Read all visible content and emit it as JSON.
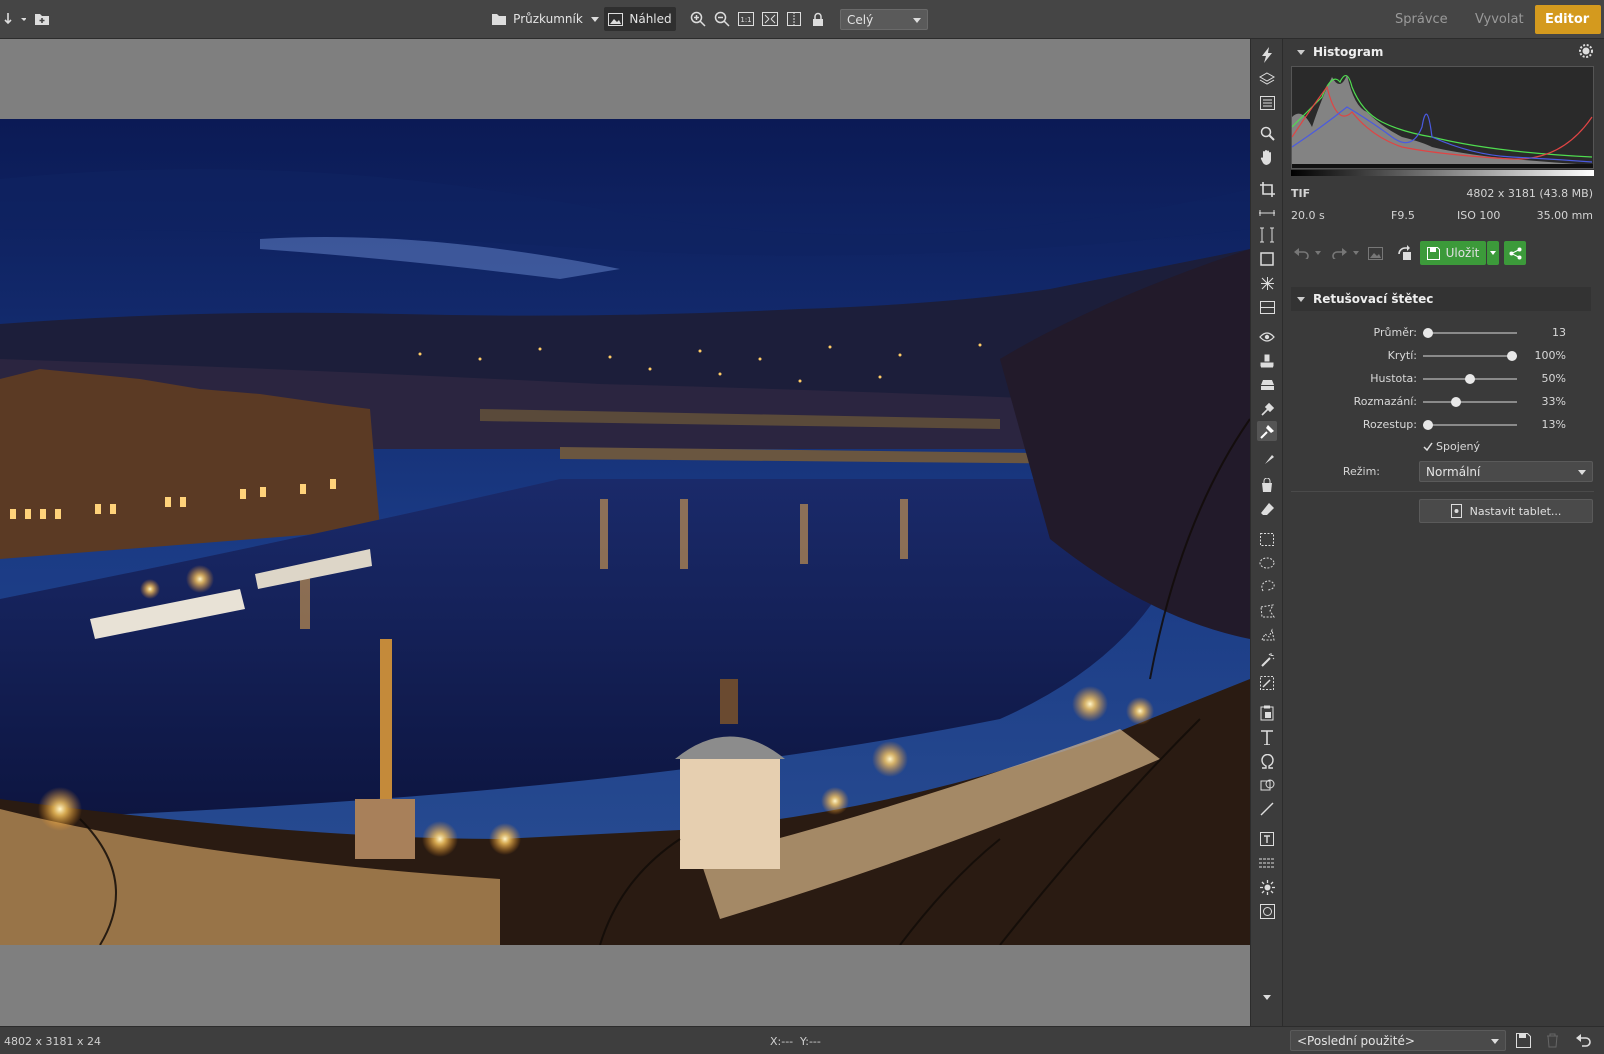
{
  "toolbar": {
    "explorer_label": "Průzkumník",
    "preview_label": "Náhled",
    "zoom_select": "Celý",
    "icons": [
      "import-arrow-icon",
      "add-folder-icon",
      "folder-icon",
      "image-icon",
      "zoom-in-icon",
      "zoom-out-icon",
      "actual-size-icon",
      "fit-icon",
      "compare-icon",
      "lock-icon"
    ]
  },
  "tabs": [
    {
      "label": "Správce",
      "active": false
    },
    {
      "label": "Vyvolat",
      "active": false
    },
    {
      "label": "Editor",
      "active": true
    }
  ],
  "histogram": {
    "title": "Histogram",
    "format": "TIF",
    "dimensions": "4802 x 3181 (43.8 MB)",
    "exposure": "20.0 s",
    "aperture": "F9.5",
    "iso": "ISO 100",
    "focal": "35.00 mm"
  },
  "actions": {
    "save_label": "Uložit"
  },
  "brush": {
    "title": "Retušovací štětec",
    "sliders": [
      {
        "label": "Průměr:",
        "value": "13",
        "pos": 0.0
      },
      {
        "label": "Krytí:",
        "value": "100%",
        "pos": 1.0
      },
      {
        "label": "Hustota:",
        "value": "50%",
        "pos": 0.5
      },
      {
        "label": "Rozmazání:",
        "value": "33%",
        "pos": 0.33
      },
      {
        "label": "Rozestup:",
        "value": "13%",
        "pos": 0.0
      }
    ],
    "connected_label": "Spojený",
    "connected_checked": true,
    "mode_label": "Režim:",
    "mode_value": "Normální",
    "tablet_label": "Nastavit tablet..."
  },
  "status": {
    "image_info": "4802 x 3181 x 24",
    "x_label": "X:---",
    "y_label": "Y:---",
    "recent": "<Poslední použité>"
  },
  "colors": {
    "accent": "#d49a1e",
    "save_green": "#3c9a3a"
  }
}
